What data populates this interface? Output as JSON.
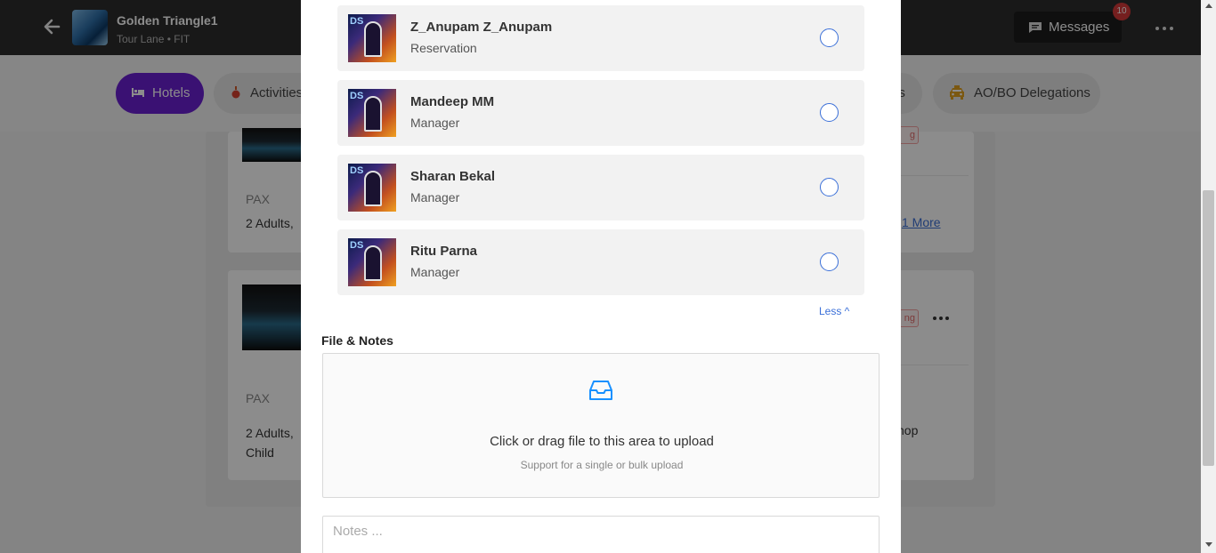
{
  "app": {
    "title": "Golden Triangle1",
    "subtitle": "Tour Lane • FIT",
    "messages_label": "Messages",
    "messages_count": "10"
  },
  "tabs": [
    {
      "label": "Hotels",
      "icon": "bed-icon",
      "active": true
    },
    {
      "label": "Activities",
      "icon": "activity-icon",
      "active": false
    },
    {
      "label": "es",
      "icon": "",
      "active": false
    },
    {
      "label": "AO/BO Delegations",
      "icon": "taxi-icon",
      "active": false
    }
  ],
  "background_cards": [
    {
      "pax_label": "PAX",
      "pax_value": "2 Adults,",
      "more_link": "1 More",
      "status": "g"
    },
    {
      "pax_label": "PAX",
      "pax_value": "2 Adults, Child",
      "status": "ng",
      "trailing_text": "hop"
    }
  ],
  "modal": {
    "users": [
      {
        "name": "Z_Anupam Z_Anupam",
        "role": "Reservation",
        "selected": false
      },
      {
        "name": "Mandeep MM",
        "role": "Manager",
        "selected": false
      },
      {
        "name": "Sharan Bekal",
        "role": "Manager",
        "selected": false
      },
      {
        "name": "Ritu Parna",
        "role": "Manager",
        "selected": false
      }
    ],
    "less_label": "Less ^",
    "files_section_title": "File & Notes",
    "upload": {
      "heading": "Click or drag file to this area to upload",
      "hint": "Support for a single or bulk upload"
    },
    "notes": {
      "value": "",
      "placeholder": "Notes ..."
    }
  },
  "colors": {
    "accent": "#6a1fd1",
    "link": "#3a6fd8",
    "topbar": "#2c2c2c",
    "badge": "#d63a3a"
  }
}
